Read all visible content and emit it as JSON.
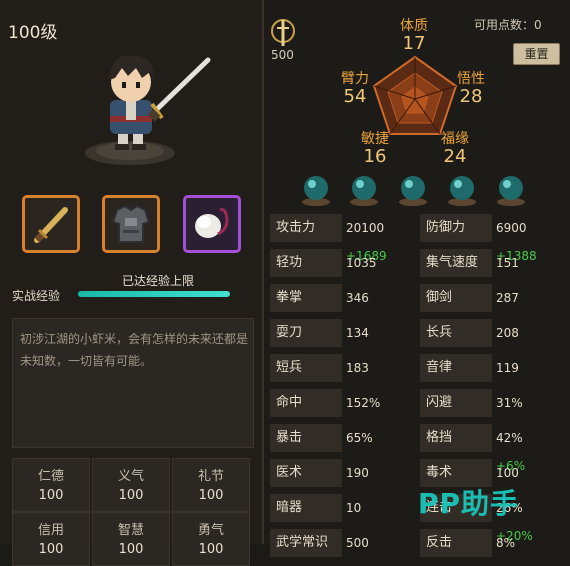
{
  "character": {
    "level": "100级",
    "exp_label": "实战经验",
    "exp_status": "已达经验上限",
    "exp_fill": 1.0,
    "description": "初涉江湖的小虾米，会有怎样的未来还都是未知数，一切皆有可能。"
  },
  "equipment": [
    {
      "name": "sword-slot",
      "icon": "sword-icon",
      "border": "#d7812e"
    },
    {
      "name": "armor-slot",
      "icon": "armor-icon",
      "border": "#d7812e"
    },
    {
      "name": "accessory-slot",
      "icon": "feather-fan-icon",
      "border": "#a44fd6"
    }
  ],
  "virtues": [
    {
      "name": "仁德",
      "value": "100"
    },
    {
      "name": "义气",
      "value": "100"
    },
    {
      "name": "礼节",
      "value": "100"
    },
    {
      "name": "信用",
      "value": "100"
    },
    {
      "name": "智慧",
      "value": "100"
    },
    {
      "name": "勇气",
      "value": "100"
    }
  ],
  "points": {
    "icon": "sword-emblem-icon",
    "total": "500",
    "available_label": "可用点数：0",
    "reset_label": "重置"
  },
  "attributes": [
    {
      "name": "体质",
      "value": "17"
    },
    {
      "name": "悟性",
      "value": "28"
    },
    {
      "name": "福缘",
      "value": "24"
    },
    {
      "name": "敏捷",
      "value": "16"
    },
    {
      "name": "臂力",
      "value": "54"
    }
  ],
  "stats_left": [
    {
      "name": "攻击力",
      "value": "20100",
      "bonus": "+1689"
    },
    {
      "name": "轻功",
      "value": "1035",
      "bonus": ""
    },
    {
      "name": "拳掌",
      "value": "346",
      "bonus": ""
    },
    {
      "name": "耍刀",
      "value": "134",
      "bonus": ""
    },
    {
      "name": "短兵",
      "value": "183",
      "bonus": ""
    },
    {
      "name": "命中",
      "value": "152%",
      "bonus": ""
    },
    {
      "name": "暴击",
      "value": "65%",
      "bonus": ""
    },
    {
      "name": "医术",
      "value": "190",
      "bonus": ""
    },
    {
      "name": "暗器",
      "value": "10",
      "bonus": ""
    },
    {
      "name": "武学常识",
      "value": "500",
      "bonus": ""
    }
  ],
  "stats_right": [
    {
      "name": "防御力",
      "value": "6900",
      "bonus": "+1388"
    },
    {
      "name": "集气速度",
      "value": "151",
      "bonus": ""
    },
    {
      "name": "御剑",
      "value": "287",
      "bonus": ""
    },
    {
      "name": "长兵",
      "value": "208",
      "bonus": ""
    },
    {
      "name": "音律",
      "value": "119",
      "bonus": ""
    },
    {
      "name": "闪避",
      "value": "31%",
      "bonus": ""
    },
    {
      "name": "格挡",
      "value": "42%",
      "bonus": "+6%"
    },
    {
      "name": "毒术",
      "value": "100",
      "bonus": ""
    },
    {
      "name": "连击",
      "value": "26%",
      "bonus": "+20%"
    },
    {
      "name": "反击",
      "value": "8%",
      "bonus": ""
    }
  ],
  "watermark": "PP助手",
  "colors": {
    "accent_orange": "#eaa33c",
    "exp_teal": "#1bb7a8",
    "bonus_green": "#48c94a"
  }
}
